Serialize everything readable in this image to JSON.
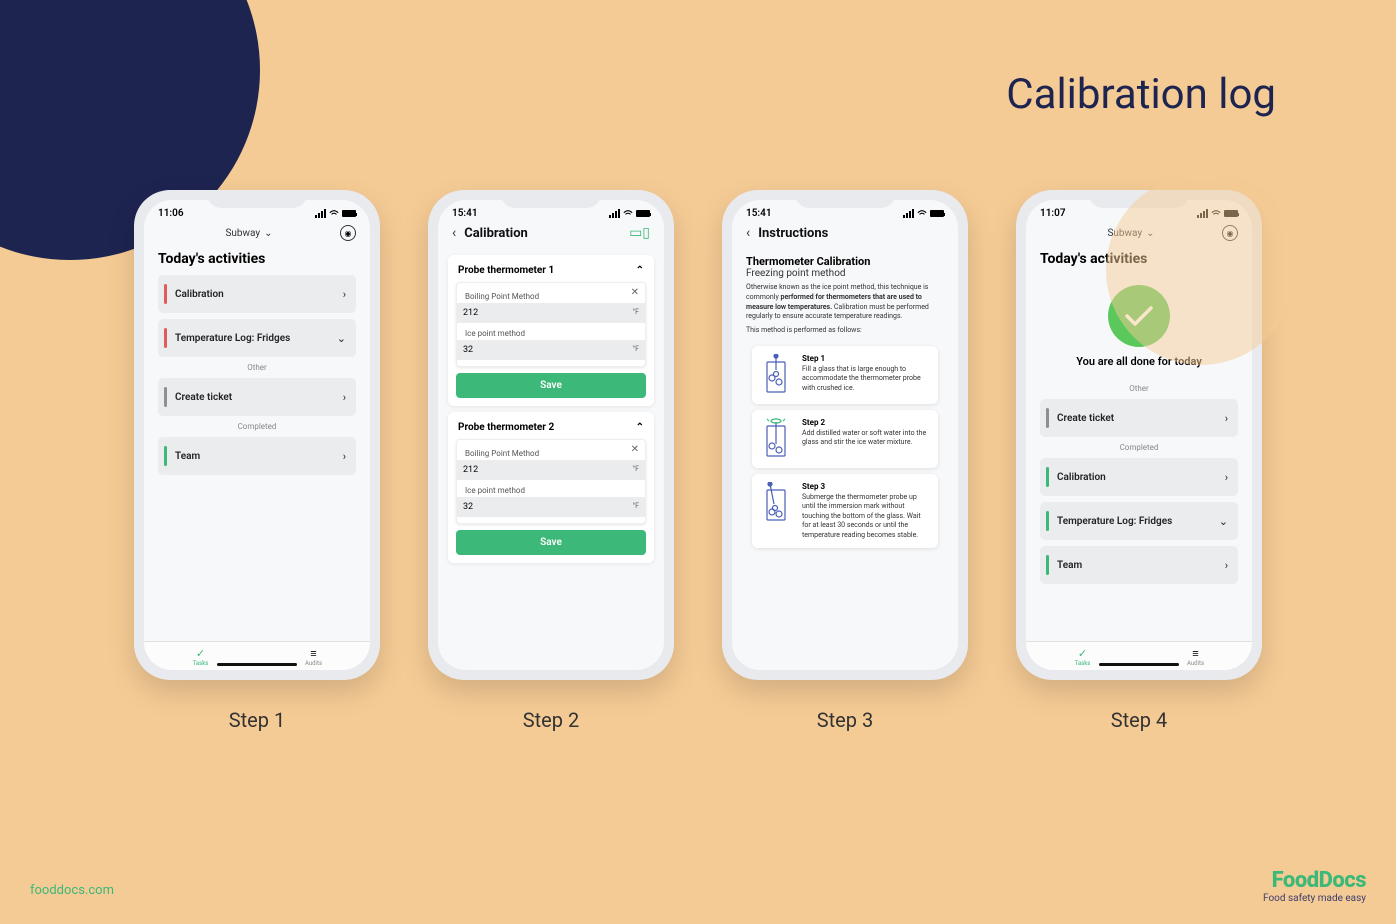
{
  "page_title": "Calibration log",
  "footer": {
    "url": "fooddocs.com",
    "brand": "FoodDocs",
    "tagline": "Food safety made easy"
  },
  "step_captions": [
    "Step 1",
    "Step 2",
    "Step 3",
    "Step 4"
  ],
  "phone1": {
    "time": "11:06",
    "location": "Subway",
    "heading": "Today's activities",
    "items": [
      {
        "label": "Calibration",
        "bar": "red",
        "chev": "right"
      },
      {
        "label": "Temperature Log: Fridges",
        "bar": "red",
        "chev": "down"
      }
    ],
    "other_label": "Other",
    "other_items": [
      {
        "label": "Create ticket",
        "bar": "grey",
        "chev": "right"
      }
    ],
    "completed_label": "Completed",
    "completed_items": [
      {
        "label": "Team",
        "bar": "green",
        "chev": "right"
      }
    ],
    "tabs": {
      "tasks": "Tasks",
      "audits": "Audits"
    }
  },
  "phone2": {
    "time": "15:41",
    "title": "Calibration",
    "probe1": {
      "name": "Probe thermometer 1",
      "method1_label": "Boiling Point Method",
      "method1_value": "212",
      "method1_unit": "°F",
      "method2_label": "Ice point method",
      "method2_value": "32",
      "method2_unit": "°F",
      "save": "Save"
    },
    "probe2": {
      "name": "Probe thermometer 2",
      "method1_label": "Boiling Point Method",
      "method1_value": "212",
      "method1_unit": "°F",
      "method2_label": "Ice point method",
      "method2_value": "32",
      "method2_unit": "°F",
      "save": "Save"
    }
  },
  "phone3": {
    "time": "15:41",
    "title": "Instructions",
    "instr_title": "Thermometer Calibration",
    "instr_sub": "Freezing point method",
    "body1": "Otherwise known as the ice point method, this technique is commonly ",
    "body1_bold": "performed for thermometers that are used to measure low temperatures.",
    "body1_after": " Calibration must be performed regularly to ensure accurate temperature readings.",
    "body2": "This method is performed as follows:",
    "steps": [
      {
        "title": "Step 1",
        "body": "Fill a glass that is large enough to accommodate the thermometer probe with crushed ice."
      },
      {
        "title": "Step 2",
        "body": "Add distilled water or soft water into the glass and stir the ice water mixture."
      },
      {
        "title": "Step 3",
        "body": "Submerge the thermometer probe up until the immersion mark without touching the bottom of the glass. Wait for at least 30 seconds or until the temperature reading becomes stable."
      }
    ]
  },
  "phone4": {
    "time": "11:07",
    "location": "Subway",
    "heading": "Today's activities",
    "done_text": "You are all done for today",
    "other_label": "Other",
    "other_items": [
      {
        "label": "Create ticket",
        "bar": "grey",
        "chev": "right"
      }
    ],
    "completed_label": "Completed",
    "completed_items": [
      {
        "label": "Calibration",
        "bar": "green",
        "chev": "right"
      },
      {
        "label": "Temperature Log: Fridges",
        "bar": "green",
        "chev": "down"
      },
      {
        "label": "Team",
        "bar": "green",
        "chev": "right"
      }
    ],
    "tabs": {
      "tasks": "Tasks",
      "audits": "Audits"
    }
  }
}
